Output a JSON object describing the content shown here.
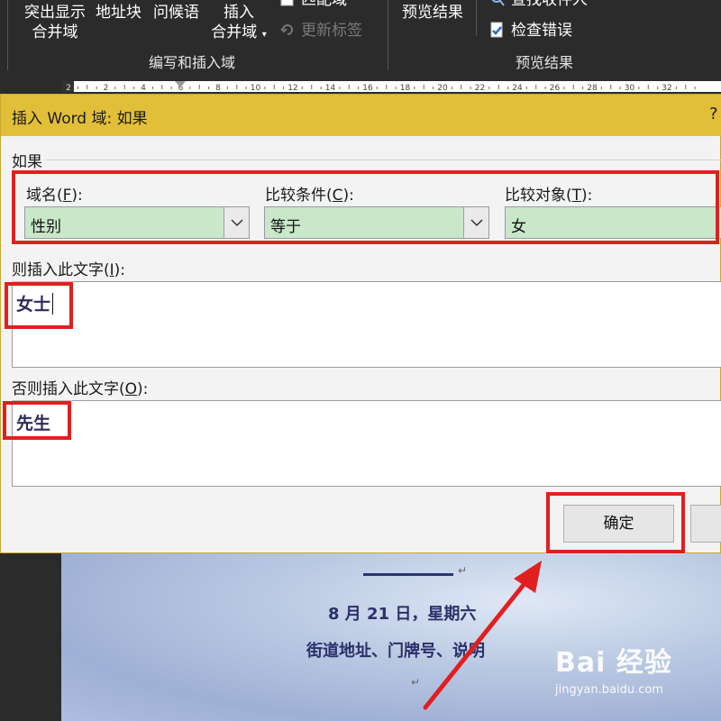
{
  "ribbon": {
    "highlight_fields_line1": "突出显示",
    "highlight_fields_line2": "合并域",
    "address_block": "地址块",
    "greeting_line": "问候语",
    "insert_merge_field_line1": "插入",
    "insert_merge_field_line2": "合并域",
    "match_fields": "匹配域",
    "update_labels": "更新标签",
    "preview_results": "预览结果",
    "find_recipient": "查找收件人",
    "check_errors": "检查错误",
    "group_write_insert": "编写和插入域",
    "group_preview": "预览结果"
  },
  "ruler": {
    "ticks": [
      "2",
      "2",
      "4",
      "6",
      "8",
      "10",
      "12",
      "14",
      "16",
      "18",
      "20",
      "22",
      "24",
      "26",
      "28",
      "30",
      "32"
    ]
  },
  "dialog": {
    "title": "插入 Word 域: 如果",
    "help": "?",
    "section_if": "如果",
    "field_name_label_prefix": "域名(",
    "field_name_label_key": "F",
    "field_name_label_suffix": "):",
    "field_name_value": "性别",
    "comparison_label_prefix": "比较条件(",
    "comparison_label_key": "C",
    "comparison_label_suffix": "):",
    "comparison_value": "等于",
    "compare_to_label_prefix": "比较对象(",
    "compare_to_label_key": "T",
    "compare_to_label_suffix": "):",
    "compare_to_value": "女",
    "insert_text_label_prefix": "则插入此文字(",
    "insert_text_label_key": "I",
    "insert_text_label_suffix": "):",
    "insert_text_value": "女士",
    "otherwise_label_prefix": "否则插入此文字(",
    "otherwise_label_key": "O",
    "otherwise_label_suffix": "):",
    "otherwise_value": "先生",
    "ok_button": "确定"
  },
  "document": {
    "date_line": "8 月 21 日，星期六",
    "address_line": "街道地址、门牌号、说明",
    "para_mark": "↵"
  },
  "watermark": {
    "brand": "Bai 经验",
    "url": "jingyan.baidu.com"
  },
  "colors": {
    "dialog_title_bar": "#e2bf39",
    "highlight_red": "#e11f1f",
    "combo_green": "#c9e7c9",
    "ribbon_bg": "#2b2b2b"
  }
}
